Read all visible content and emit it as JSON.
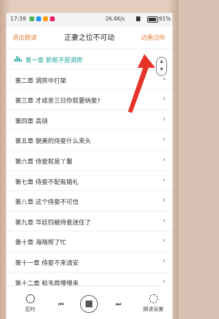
{
  "status_bar": {
    "time": "17:39",
    "speed": "26.4K/s",
    "battery": "91%"
  },
  "header": {
    "exit_label": "退出朗读",
    "title": "正妻之位不可动",
    "listen_label": "边看边听"
  },
  "chapters": [
    {
      "label": "第一章  新郎不愿洞房",
      "active": true
    },
    {
      "label": "第二章  洞房中打架"
    },
    {
      "label": "第三章  才成亲三日你就要纳妾?"
    },
    {
      "label": "第四章  高烧"
    },
    {
      "label": "第五章  貌美的侍妾什么来头"
    },
    {
      "label": "第六章  侍妾就是丫鬟"
    },
    {
      "label": "第七章  侍妾不配有婚礼"
    },
    {
      "label": "第八章  这个侍妾不可信"
    },
    {
      "label": "第九章  华廷钧被侍妾迷住了"
    },
    {
      "label": "第十章  海哨帮了忙"
    },
    {
      "label": "第十一章  侍妾不来请安"
    },
    {
      "label": "第十二章  和韦蔻慢慢来"
    }
  ],
  "bottom_bar": {
    "timer_label": "定时",
    "settings_label": "朗读设置"
  },
  "colors": {
    "accent": "#e8843d",
    "active": "#20a59a",
    "annotation": "#e5332a"
  }
}
